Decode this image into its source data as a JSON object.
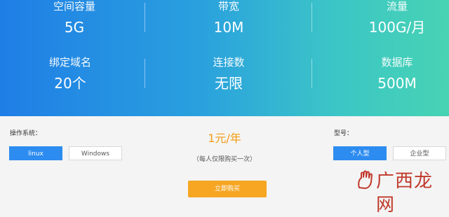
{
  "stats": {
    "row1": [
      {
        "label": "空间容量",
        "value": "5G"
      },
      {
        "label": "带宽",
        "value": "10M"
      },
      {
        "label": "流量",
        "value": "100G/月"
      }
    ],
    "row2": [
      {
        "label": "绑定域名",
        "value": "20个"
      },
      {
        "label": "连接数",
        "value": "无限"
      },
      {
        "label": "数据库",
        "value": "500M"
      }
    ]
  },
  "os": {
    "label": "操作系统：",
    "options": [
      "linux",
      "Windows"
    ],
    "selected": "linux"
  },
  "type": {
    "label": "型号：",
    "options": [
      "个人型",
      "企业型"
    ],
    "selected": "个人型"
  },
  "price": "1元/年",
  "note": "（每人仅限购买一次）",
  "buy_label": "立即购买",
  "watermark": {
    "text": "广西龙网",
    "color": "#c0392b",
    "icon": "hand-icon"
  },
  "colors": {
    "accent": "#2d8cf0",
    "price": "#f39c12",
    "buy": "#f6a623"
  }
}
